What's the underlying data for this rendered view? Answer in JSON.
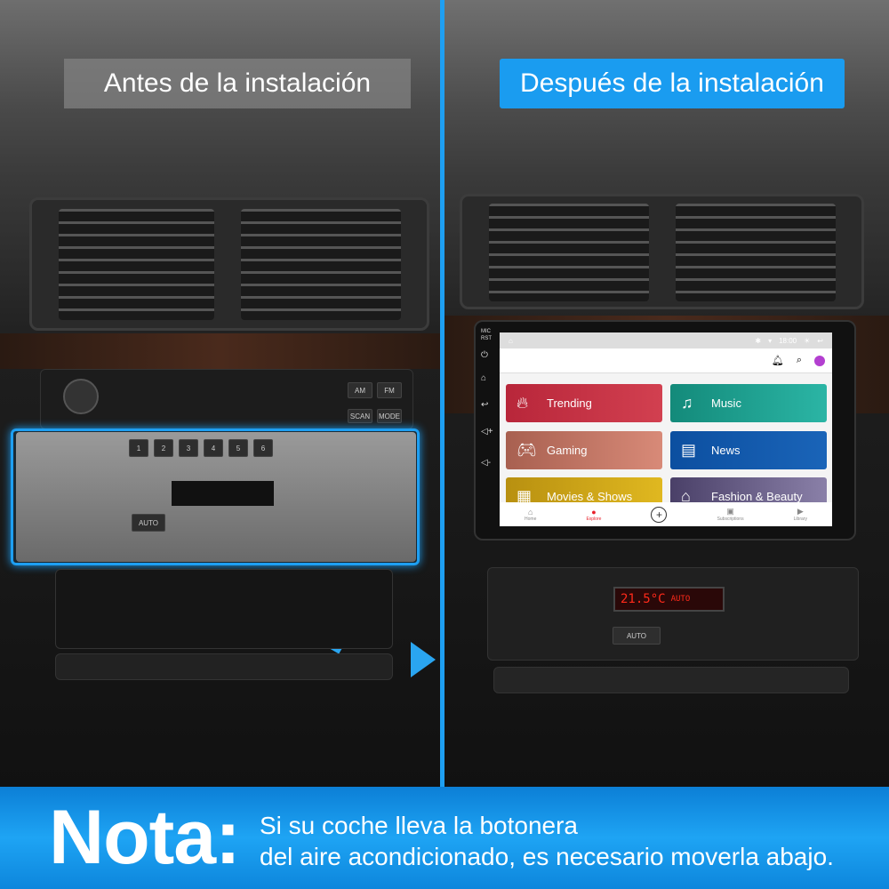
{
  "left_panel": {
    "title": "Antes de la instalación"
  },
  "right_panel": {
    "title": "Después de la instalación"
  },
  "head_unit": {
    "side_buttons": {
      "mic": "MIC",
      "rst": "RST"
    },
    "status_bar": {
      "time": "18:00"
    },
    "tiles": [
      {
        "label": "Trending",
        "color": "#b8263a",
        "icon": "flame-icon"
      },
      {
        "label": "Music",
        "color": "#138a7a",
        "icon": "music-note-icon"
      },
      {
        "label": "Gaming",
        "color": "#b06a5a",
        "icon": "gamepad-icon"
      },
      {
        "label": "News",
        "color": "#0c4fa0",
        "icon": "newspaper-icon"
      },
      {
        "label": "Movies & Shows",
        "color": "#c8a010",
        "icon": "film-icon"
      },
      {
        "label": "Fashion & Beauty",
        "color": "#5a5078",
        "icon": "hanger-icon"
      }
    ],
    "nav": [
      {
        "label": "Home"
      },
      {
        "label": "Explore",
        "active": true
      },
      {
        "label": ""
      },
      {
        "label": "Subscriptions"
      },
      {
        "label": "Library"
      }
    ]
  },
  "climate_display": {
    "temperature": "21.5°C",
    "mode": "AUTO"
  },
  "climate_buttons": {
    "auto": "AUTO"
  },
  "radio": {
    "am": "AM",
    "fm": "FM",
    "scan": "SCAN",
    "mode": "MODE",
    "presets": [
      "1",
      "2",
      "3",
      "4",
      "5",
      "6"
    ]
  },
  "banner": {
    "heading": "Nota:",
    "line1": "Si su coche lleva la botonera",
    "line2": "del aire acondicionado, es necesario moverla abajo."
  },
  "colors": {
    "accent": "#1e9ff2",
    "explore_active": "#e8202a"
  }
}
